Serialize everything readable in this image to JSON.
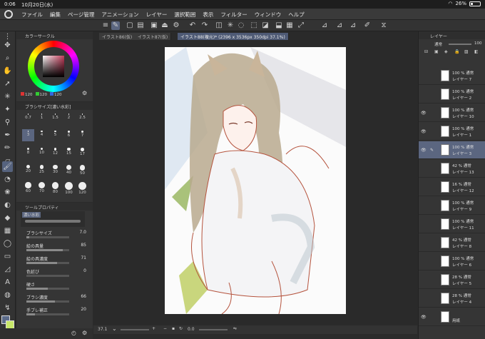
{
  "status": {
    "time": "0:06",
    "date": "10月20日(水)",
    "battery": "26%",
    "battery_level": 0.26
  },
  "menu": {
    "items": [
      "ファイル",
      "編集",
      "ページ管理",
      "アニメーション",
      "レイヤー",
      "選択範囲",
      "表示",
      "フィルター",
      "ウィンドウ",
      "ヘルプ"
    ]
  },
  "color_panel": {
    "title": "カラーサークル",
    "r": "120",
    "g": "120",
    "b": "120"
  },
  "brush_panel": {
    "title": "ブラシサイズ[濃い水彩]",
    "sizes": [
      "0.7",
      "1",
      "1.5",
      "2",
      "2.5",
      "3",
      "4",
      "5",
      "6",
      "7",
      "8",
      "10",
      "12",
      "15",
      "17",
      "20",
      "25",
      "30",
      "40",
      "50",
      "60",
      "70",
      "80",
      "100",
      "120"
    ],
    "selected": "3"
  },
  "tool_property": {
    "title": "ツールプロパティ",
    "subtool": "濃い水彩",
    "props": [
      {
        "label": "ブラシサイズ",
        "value": "7.0",
        "level": 0.07
      },
      {
        "label": "絵の具量",
        "value": "85",
        "level": 0.85
      },
      {
        "label": "絵の具濃度",
        "value": "71",
        "level": 0.71
      },
      {
        "label": "色延び",
        "value": "0",
        "level": 0
      },
      {
        "label": "硬さ",
        "value": "",
        "level": 0.5
      },
      {
        "label": "ブラシ濃度",
        "value": "66",
        "level": 0.66
      },
      {
        "label": "手ブレ補正",
        "value": "20",
        "level": 0.2
      }
    ]
  },
  "doc_tabs": [
    "イラスト86(仮)",
    "イラスト87(仮)",
    "イラスト88(複元)* (2396 x 3536px 350dpi 37.1%)"
  ],
  "canvas_bottom": {
    "zoom": "37.1",
    "rotation": "0.0"
  },
  "layer_panel": {
    "title": "レイヤー",
    "blend": "通常",
    "opacity": "100",
    "layers": [
      {
        "opacity": "100 %",
        "mode": "通常",
        "name": "レイヤー 7",
        "visible": false,
        "selected": false
      },
      {
        "opacity": "100 %",
        "mode": "通常",
        "name": "レイヤー 2",
        "visible": false,
        "selected": false
      },
      {
        "opacity": "100 %",
        "mode": "通常",
        "name": "レイヤー 10",
        "visible": true,
        "selected": false
      },
      {
        "opacity": "100 %",
        "mode": "通常",
        "name": "レイヤー 1",
        "visible": true,
        "selected": false
      },
      {
        "opacity": "100 %",
        "mode": "通常",
        "name": "レイヤー 3",
        "visible": true,
        "selected": true
      },
      {
        "opacity": "42 %",
        "mode": "通常",
        "name": "レイヤー 13",
        "visible": false,
        "selected": false
      },
      {
        "opacity": "16 %",
        "mode": "通常",
        "name": "レイヤー 12",
        "visible": false,
        "selected": false
      },
      {
        "opacity": "100 %",
        "mode": "通常",
        "name": "レイヤー 9",
        "visible": false,
        "selected": false
      },
      {
        "opacity": "100 %",
        "mode": "通常",
        "name": "レイヤー 11",
        "visible": false,
        "selected": false
      },
      {
        "opacity": "42 %",
        "mode": "通常",
        "name": "レイヤー 8",
        "visible": false,
        "selected": false
      },
      {
        "opacity": "100 %",
        "mode": "通常",
        "name": "レイヤー 6",
        "visible": false,
        "selected": false
      },
      {
        "opacity": "28 %",
        "mode": "通常",
        "name": "レイヤー 5",
        "visible": false,
        "selected": false
      },
      {
        "opacity": "28 %",
        "mode": "通常",
        "name": "レイヤー 4",
        "visible": false,
        "selected": false
      },
      {
        "opacity": "",
        "mode": "",
        "name": "用紙",
        "visible": true,
        "selected": false
      }
    ]
  }
}
